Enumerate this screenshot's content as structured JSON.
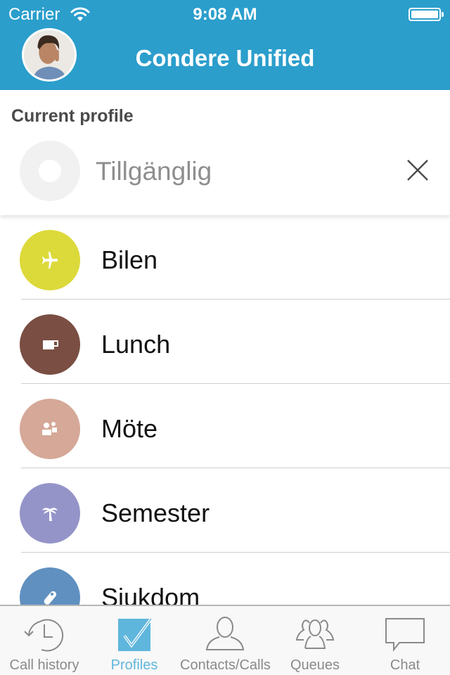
{
  "status_bar": {
    "carrier": "Carrier",
    "time": "9:08 AM",
    "battery_level_percent": 100
  },
  "header": {
    "title": "Condere Unified",
    "avatar_icon": "user-avatar-photo"
  },
  "current_profile": {
    "section_label": "Current profile",
    "name": "Tillgänglig",
    "icon": "empty-circle-icon",
    "clear_icon": "close-icon"
  },
  "profiles": [
    {
      "name": "Bilen",
      "icon": "airplane-icon",
      "color": "#dcd93a"
    },
    {
      "name": "Lunch",
      "icon": "coffee-cup-icon",
      "color": "#7a4e42"
    },
    {
      "name": "Möte",
      "icon": "meeting-people-icon",
      "color": "#d5a898"
    },
    {
      "name": "Semester",
      "icon": "palm-tree-icon",
      "color": "#9594c9"
    },
    {
      "name": "Sjukdom",
      "icon": "pill-icon",
      "color": "#6090c0"
    }
  ],
  "tabbar": {
    "active_color": "#5fb6dc",
    "tabs": [
      {
        "label": "Call history",
        "icon": "history-clock-icon",
        "active": false
      },
      {
        "label": "Profiles",
        "icon": "checkmark-square-icon",
        "active": true
      },
      {
        "label": "Contacts/Calls",
        "icon": "person-icon",
        "active": false
      },
      {
        "label": "Queues",
        "icon": "group-icon",
        "active": false
      },
      {
        "label": "Chat",
        "icon": "speech-bubble-icon",
        "active": false
      }
    ]
  }
}
